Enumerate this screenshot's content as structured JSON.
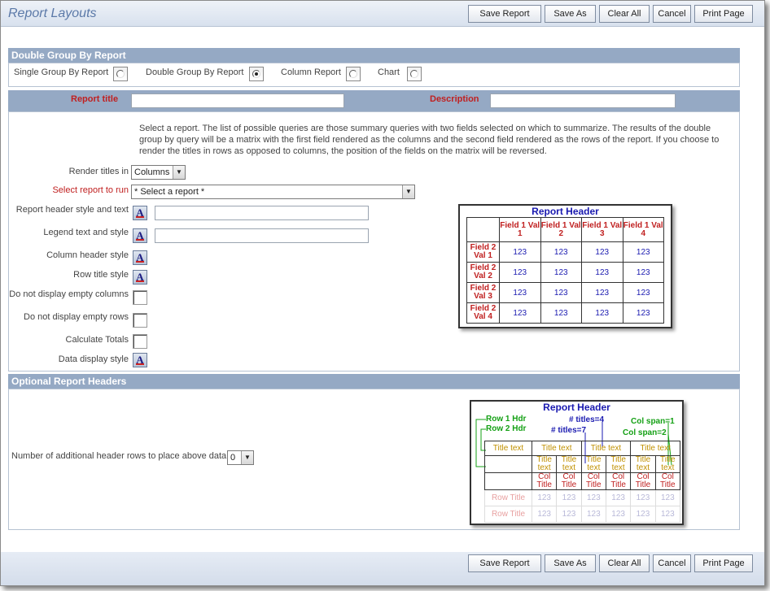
{
  "page": {
    "title": "Report Layouts"
  },
  "toolbar": {
    "save_report": "Save Report",
    "save_as": "Save As",
    "clear_all": "Clear All",
    "cancel": "Cancel",
    "print_page": "Print Page"
  },
  "type_section": {
    "header": "Double Group By Report",
    "options": [
      {
        "label": "Single Group By Report",
        "selected": false
      },
      {
        "label": "Double Group By Report",
        "selected": true
      },
      {
        "label": "Column Report",
        "selected": false
      },
      {
        "label": "Chart",
        "selected": false
      }
    ]
  },
  "title_row": {
    "report_title_label": "Report title",
    "report_title_value": "",
    "description_label": "Description",
    "description_value": ""
  },
  "description_text": "Select a report. The list of possible queries are those summary queries with two fields selected on which to summarize. The results of the double group by query will be a matrix with the first field rendered as the columns and the second field rendered as the rows of the report. If you choose to render the titles in rows as opposed to columns, the position of the fields on the matrix will be reversed.",
  "form": {
    "render_titles_label": "Render titles in",
    "render_titles_value": "Columns",
    "select_report_label": "Select report to run",
    "select_report_value": "* Select a report *",
    "header_style_label": "Report header style and text",
    "header_text_value": "",
    "legend_label": "Legend text and style",
    "legend_value": "",
    "column_header_label": "Column header style",
    "row_title_label": "Row title style",
    "no_empty_cols_label": "Do not display empty columns",
    "no_empty_rows_label": "Do not display empty rows",
    "calc_totals_label": "Calculate Totals",
    "data_display_label": "Data display style"
  },
  "matrix_preview": {
    "header": "Report Header",
    "columns": [
      "Field 1 Val 1",
      "Field 1 Val 2",
      "Field 1 Val 3",
      "Field 1 Val 4"
    ],
    "rows": [
      "Field 2 Val 1",
      "Field 2 Val 2",
      "Field 2 Val 3",
      "Field 2 Val 4"
    ],
    "cell_value": "123"
  },
  "optional_section": {
    "header": "Optional Report Headers",
    "rows_label": "Number of additional header rows to place above data",
    "rows_value": "0"
  },
  "header_preview": {
    "header": "Report Header",
    "row1": "Row 1 Hdr",
    "row2": "Row 2 Hdr",
    "titles4": "# titles=4",
    "titles7": "# titles=7",
    "colspan1": "Col span=1",
    "colspan2": "Col span=2",
    "title_text": "Title text",
    "title_short_1": "Title",
    "title_short_2": "text",
    "col_title_1": "Col",
    "col_title_2": "Title",
    "row_title": "Row Title",
    "value": "123"
  },
  "colors": {
    "section_header": "#95a9c4",
    "required_label": "#c02020",
    "accent_blue": "#1a1ab0",
    "annotation_green": "#14a014"
  }
}
